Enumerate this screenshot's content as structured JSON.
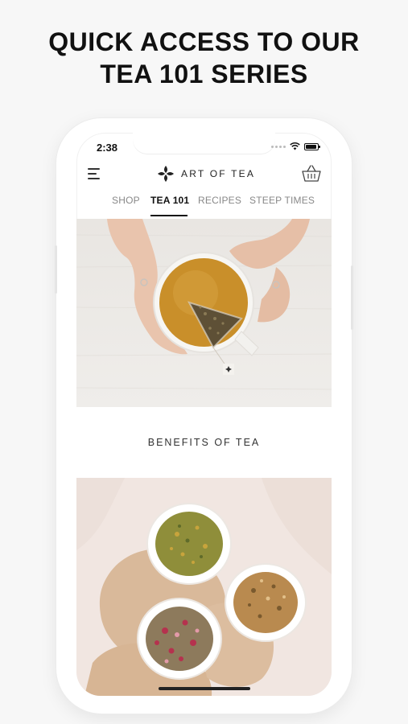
{
  "headline": {
    "line1": "QUICK ACCESS TO OUR",
    "line2": "TEA 101 SERIES"
  },
  "status_bar": {
    "time": "2:38",
    "icons": [
      "signal-icon",
      "wifi-icon",
      "battery-icon"
    ]
  },
  "header": {
    "logo_text": "ART OF TEA",
    "icons": [
      "menu-icon",
      "logo-icon",
      "basket-icon"
    ]
  },
  "tabs": [
    {
      "label": "SHOP",
      "active": false
    },
    {
      "label": "TEA 101",
      "active": true
    },
    {
      "label": "RECIPES",
      "active": false
    },
    {
      "label": "STEEP TIMES",
      "active": false
    }
  ],
  "content": {
    "section_title": "BENEFITS OF TEA"
  },
  "colors": {
    "background": "#f7f7f7",
    "text_dark": "#111111",
    "tab_inactive": "#888888",
    "photo_bg_1": "#ebe8e4",
    "photo_bg_2": "#f1e6e1",
    "tea_amber": "#c98f2a"
  }
}
